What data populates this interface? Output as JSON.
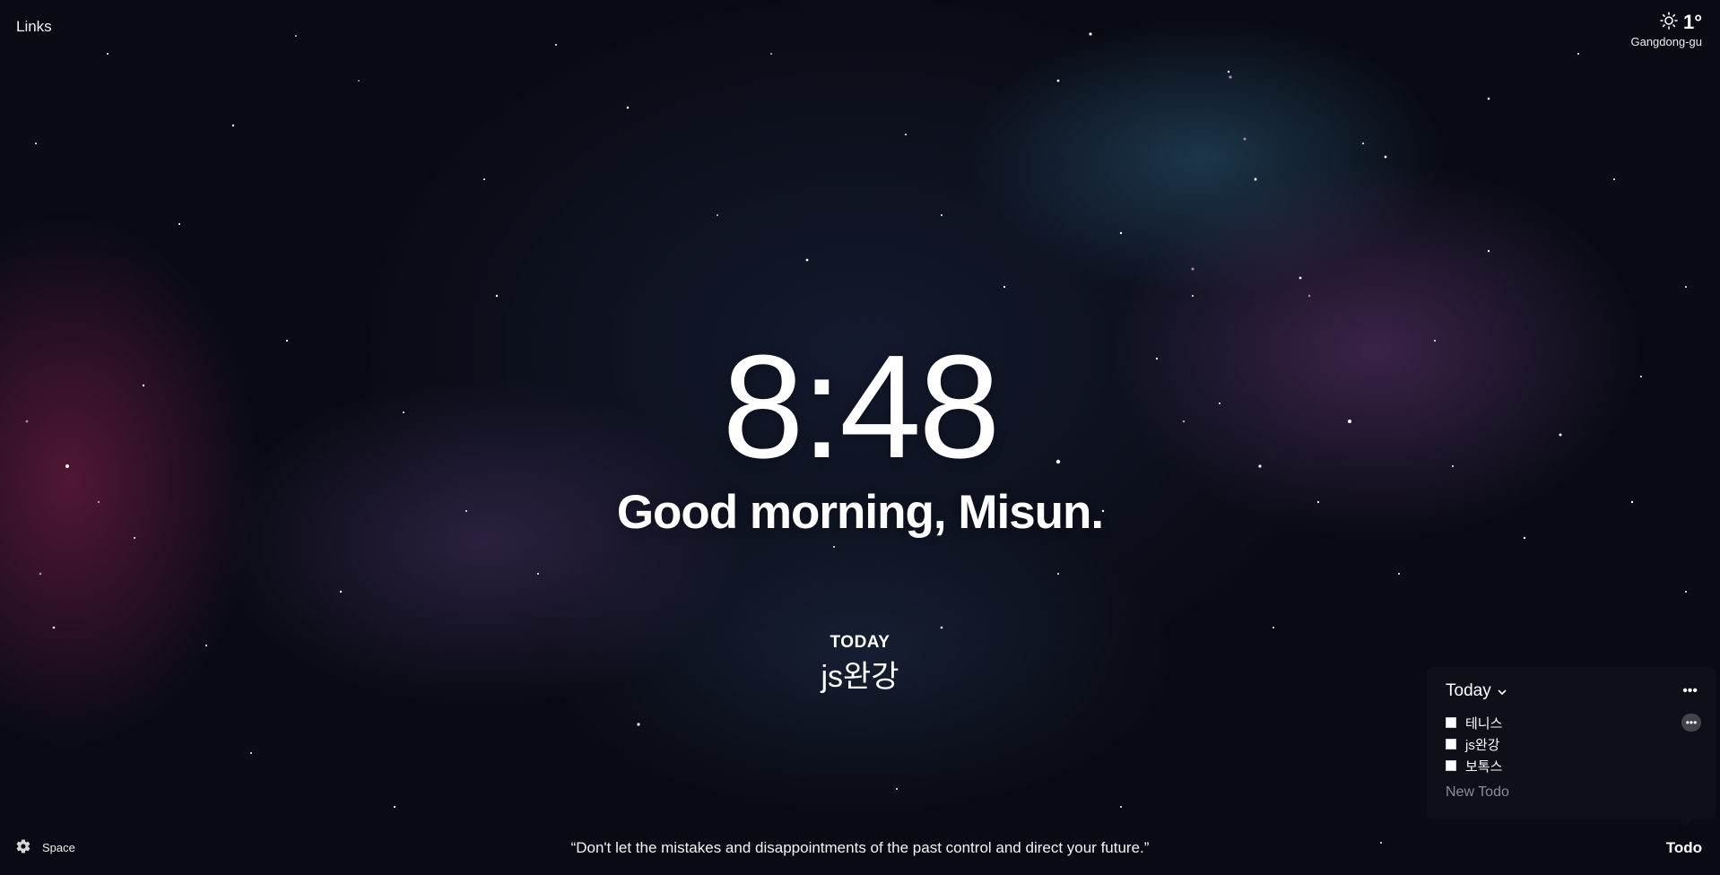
{
  "top_left": {
    "links_label": "Links"
  },
  "weather": {
    "icon": "sun-icon",
    "temperature": "1°",
    "location": "Gangdong-gu"
  },
  "clock": {
    "time": "8:48"
  },
  "greeting": {
    "text": "Good morning, Misun."
  },
  "focus": {
    "label": "TODAY",
    "text": "js완강"
  },
  "quote": {
    "text": "“Don't let the mistakes and disappointments of the past control and direct your future.”"
  },
  "settings": {
    "icon": "gear-icon",
    "space_label": "Space"
  },
  "todo": {
    "toggle_label": "Todo",
    "panel_title": "Today",
    "items": [
      {
        "label": "테니스",
        "checked": false
      },
      {
        "label": "js완강",
        "checked": false
      },
      {
        "label": "보톡스",
        "checked": false
      }
    ],
    "new_todo_placeholder": "New Todo"
  },
  "colors": {
    "text": "#ffffff",
    "panel_bg": "#0e101a",
    "placeholder": "#8a8d95"
  }
}
